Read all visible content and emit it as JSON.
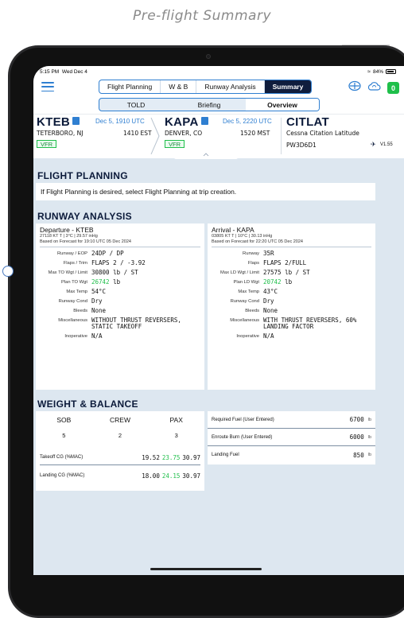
{
  "caption": "Pre-flight Summary",
  "status": {
    "time": "5:15 PM",
    "date": "Wed Dec 4",
    "battery": "84%"
  },
  "nav": {
    "tabs": [
      "Flight Planning",
      "W & B",
      "Runway Analysis",
      "Summary"
    ],
    "active_tab": "Summary",
    "badge": "0",
    "subtabs": [
      "TOLD",
      "Briefing",
      "Overview"
    ],
    "active_subtab": "Overview"
  },
  "flight": {
    "dep": {
      "code": "KTEB",
      "city": "TETERBORO, NJ",
      "date": "Dec 5, 1910 UTC",
      "local": "1410 EST",
      "rules": "VFR"
    },
    "arr": {
      "code": "KAPA",
      "city": "DENVER, CO",
      "date": "Dec 5, 2220 UTC",
      "local": "1520 MST",
      "rules": "VFR"
    },
    "aircraft": {
      "callsign": "CITLAT",
      "type": "Cessna Citation Latitude",
      "reg": "PW3D6D1",
      "version": "V1.55"
    }
  },
  "flight_planning": {
    "title": "FLIGHT PLANNING",
    "note": "If Flight Planning is desired, select Flight Planning at trip creation."
  },
  "runway_analysis": {
    "title": "RUNWAY ANALYSIS",
    "departure": {
      "head": "Departure - KTEB",
      "wx": "27118 KT T | 3°C | 29.57 inHg",
      "forecast": "Based on Forecast for 19:10 UTC 05 Dec 2024",
      "rows": [
        {
          "label": "Runway / EOP",
          "value": "24DP / DP"
        },
        {
          "label": "Flaps / Trim",
          "value": "FLAPS 2 / -3.92"
        },
        {
          "label": "Max TO Wgt / Limit",
          "value": "30800 lb / ST"
        },
        {
          "label": "Plan TO Wgt",
          "value": "26742",
          "unit": " lb",
          "green": true
        },
        {
          "label": "Max Temp",
          "value": "54°C"
        },
        {
          "label": "Runway Cond",
          "value": "Dry"
        },
        {
          "label": "Bleeds",
          "value": "None"
        },
        {
          "label": "Miscellaneous",
          "value": "WITHOUT THRUST REVERSERS,\nSTATIC TAKEOFF"
        },
        {
          "label": "Inoperative",
          "value": "N/A"
        }
      ]
    },
    "arrival": {
      "head": "Arrival - KAPA",
      "wx": "03805 KT T | 10°C | 30.13 inHg",
      "forecast": "Based on Forecast for 22:20 UTC 05 Dec 2024",
      "rows": [
        {
          "label": "Runway",
          "value": "35R"
        },
        {
          "label": "Flaps",
          "value": "FLAPS 2/FULL"
        },
        {
          "label": "Max LD Wgt / Limit",
          "value": "27575 lb / ST"
        },
        {
          "label": "Plan LD Wgt",
          "value": "20742",
          "unit": " lb",
          "green": true
        },
        {
          "label": "Max Temp",
          "value": "43°C"
        },
        {
          "label": "Runway Cond",
          "value": "Dry"
        },
        {
          "label": "Bleeds",
          "value": "None"
        },
        {
          "label": "Miscellaneous",
          "value": "WITH THRUST REVERSERS, 60%\nLANDING FACTOR"
        },
        {
          "label": "Inoperative",
          "value": "N/A"
        }
      ]
    }
  },
  "weight_balance": {
    "title": "WEIGHT & BALANCE",
    "headers": [
      "SOB",
      "CREW",
      "PAX"
    ],
    "values": [
      "5",
      "2",
      "3"
    ],
    "takeoff_cg": {
      "label": "Takeoff CG (%MAC)",
      "a": "19.52",
      "b": "23.75",
      "c": "30.97"
    },
    "landing_cg": {
      "label": "Landing CG (%MAC)",
      "a": "18.00",
      "b": "24.15",
      "c": "30.97"
    },
    "fuel": [
      {
        "label": "Required Fuel (User Entered)",
        "value": "6700",
        "unit": "lb"
      },
      {
        "label": "Enroute Burn (User Entered)",
        "value": "6000",
        "unit": "lb"
      },
      {
        "label": "Landing Fuel",
        "value": "850",
        "unit": "lb"
      }
    ]
  }
}
